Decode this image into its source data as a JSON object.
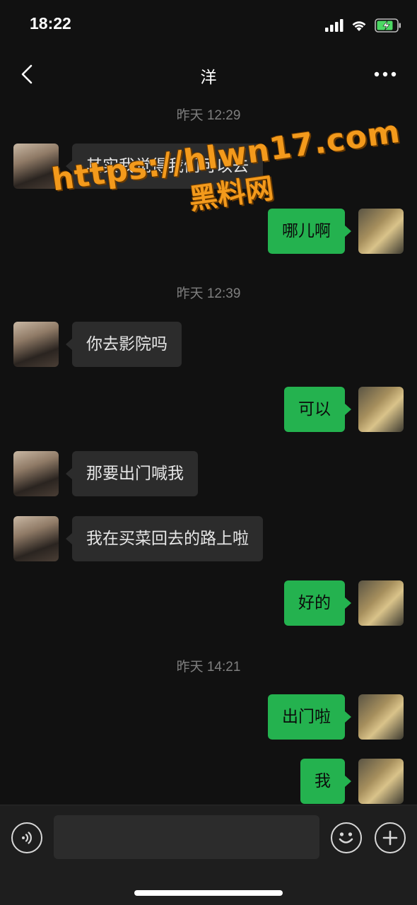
{
  "status_bar": {
    "time": "18:22",
    "icons": [
      "signal-icon",
      "wifi-icon",
      "battery-charging-icon"
    ],
    "battery_color": "#4cd964"
  },
  "nav": {
    "title": "洋",
    "back_icon": "chevron-left-icon",
    "more_icon": "more-dots-icon"
  },
  "messages": [
    {
      "type": "timestamp",
      "text": "昨天 12:29"
    },
    {
      "type": "received",
      "text": "其实我觉得我们可以去"
    },
    {
      "type": "sent",
      "text": "哪儿啊"
    },
    {
      "type": "timestamp",
      "text": "昨天 12:39"
    },
    {
      "type": "received",
      "text": "你去影院吗"
    },
    {
      "type": "sent",
      "text": "可以"
    },
    {
      "type": "received",
      "text": "那要出门喊我"
    },
    {
      "type": "received",
      "text": "我在买菜回去的路上啦"
    },
    {
      "type": "sent",
      "text": "好的"
    },
    {
      "type": "timestamp",
      "text": "昨天 14:21"
    },
    {
      "type": "sent",
      "text": "出门啦"
    },
    {
      "type": "sent",
      "text": "我"
    }
  ],
  "watermark": {
    "url": "https://hlwn17.com",
    "name": "黑料网"
  },
  "input_bar": {
    "placeholder": "",
    "icons": [
      "voice-icon",
      "emoji-icon",
      "plus-icon"
    ]
  },
  "colors": {
    "background": "#111111",
    "sent_bubble": "#24b24f",
    "received_bubble": "#2c2c2c",
    "timestamp": "#7f7f7f",
    "watermark": "#f39a1c"
  }
}
